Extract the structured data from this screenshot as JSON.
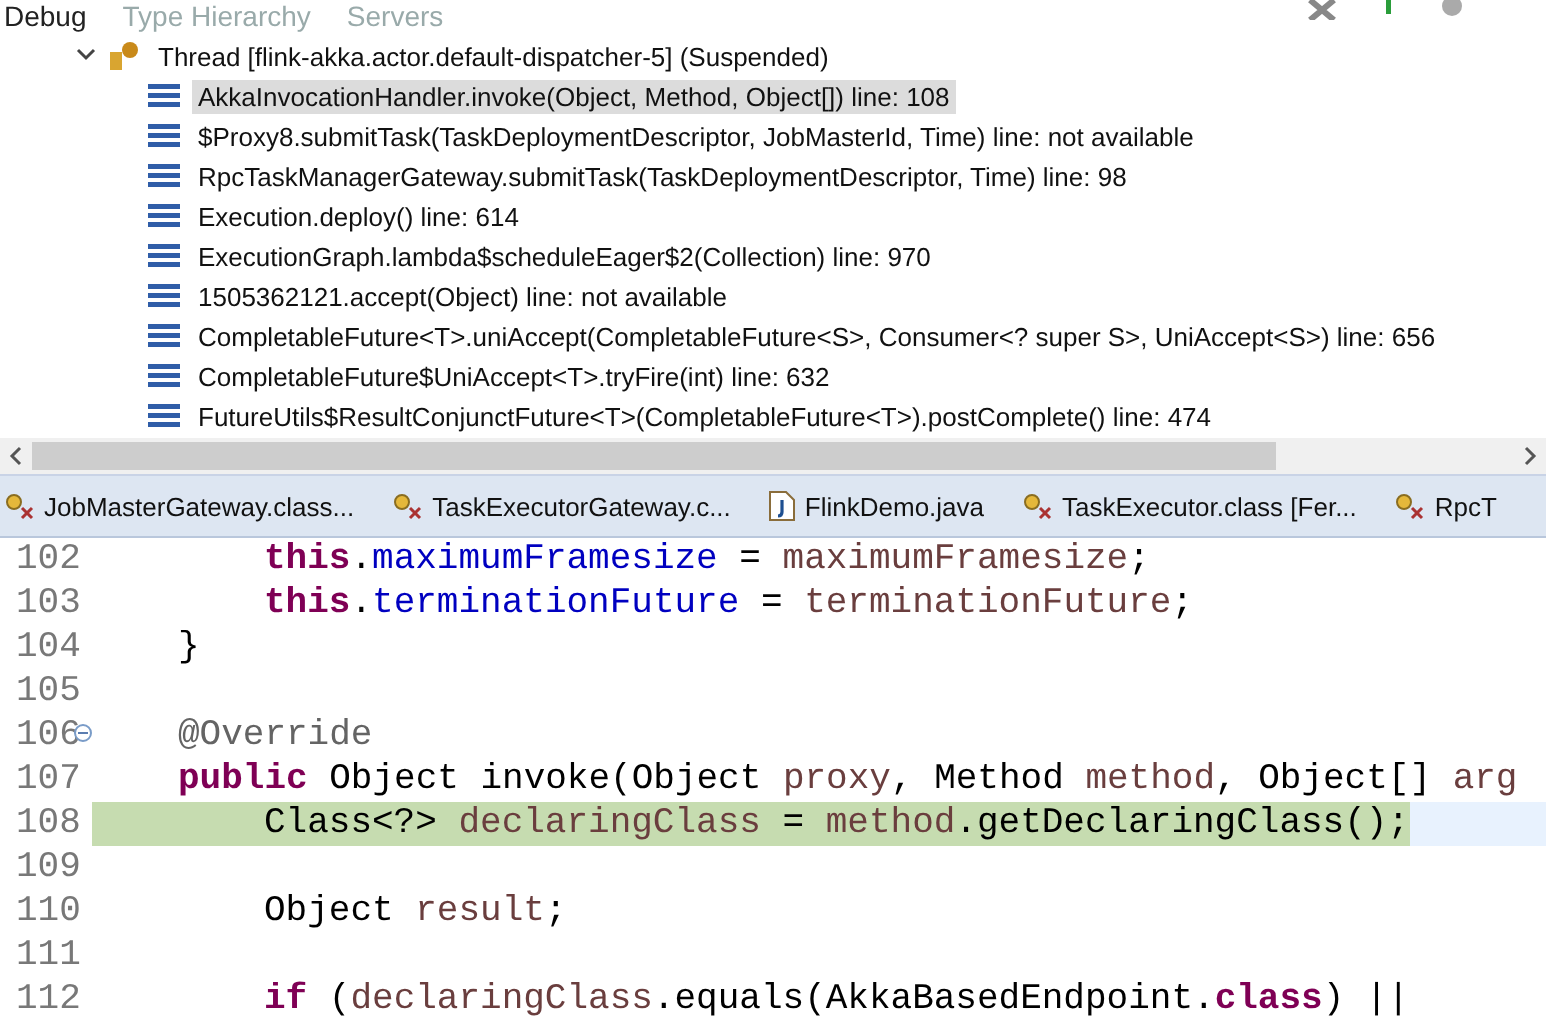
{
  "view_tabs": [
    {
      "label": "Debug",
      "selected": true
    },
    {
      "label": "Type Hierarchy",
      "selected": false
    },
    {
      "label": "Servers",
      "selected": false
    }
  ],
  "thread": {
    "label": "Thread [flink-akka.actor.default-dispatcher-5] (Suspended)",
    "expanded": true,
    "frames": [
      {
        "label": "AkkaInvocationHandler.invoke(Object, Method, Object[]) line: 108",
        "selected": true
      },
      {
        "label": "$Proxy8.submitTask(TaskDeploymentDescriptor, JobMasterId, Time) line: not available",
        "selected": false
      },
      {
        "label": "RpcTaskManagerGateway.submitTask(TaskDeploymentDescriptor, Time) line: 98",
        "selected": false
      },
      {
        "label": "Execution.deploy() line: 614",
        "selected": false
      },
      {
        "label": "ExecutionGraph.lambda$scheduleEager$2(Collection) line: 970",
        "selected": false
      },
      {
        "label": "1505362121.accept(Object) line: not available",
        "selected": false
      },
      {
        "label": "CompletableFuture<T>.uniAccept(CompletableFuture<S>, Consumer<? super S>, UniAccept<S>) line: 656",
        "selected": false
      },
      {
        "label": "CompletableFuture$UniAccept<T>.tryFire(int) line: 632",
        "selected": false
      },
      {
        "label": "FutureUtils$ResultConjunctFuture<T>(CompletableFuture<T>).postComplete() line: 474",
        "selected": false
      }
    ]
  },
  "editor_tabs": [
    {
      "label": "JobMasterGateway.class...",
      "kind": "class"
    },
    {
      "label": "TaskExecutorGateway.c...",
      "kind": "class"
    },
    {
      "label": "FlinkDemo.java",
      "kind": "java"
    },
    {
      "label": "TaskExecutor.class [Fer...",
      "kind": "class"
    },
    {
      "label": "RpcT",
      "kind": "class"
    }
  ],
  "code_lines": [
    {
      "number": "102",
      "current": false,
      "kind": "statement",
      "tokens": [
        {
          "kind": "keyword",
          "text": "this"
        },
        {
          "kind": "plain",
          "text": "."
        },
        {
          "kind": "field",
          "text": "maximumFramesize"
        },
        {
          "kind": "plain",
          "text": " = "
        },
        {
          "kind": "var",
          "text": "maximumFramesize"
        },
        {
          "kind": "plain",
          "text": ";"
        }
      ]
    },
    {
      "number": "103",
      "current": false,
      "kind": "statement",
      "tokens": [
        {
          "kind": "keyword",
          "text": "this"
        },
        {
          "kind": "plain",
          "text": "."
        },
        {
          "kind": "field",
          "text": "terminationFuture"
        },
        {
          "kind": "plain",
          "text": " = "
        },
        {
          "kind": "var",
          "text": "terminationFuture"
        },
        {
          "kind": "plain",
          "text": ";"
        }
      ]
    },
    {
      "number": "104",
      "current": false,
      "kind": "member",
      "tokens": [
        {
          "kind": "plain",
          "text": "}"
        }
      ]
    },
    {
      "number": "105",
      "current": false
    },
    {
      "number": "106",
      "current": false,
      "foldable": true,
      "kind": "member",
      "tokens": [
        {
          "kind": "annotation",
          "text": "@Override"
        }
      ]
    },
    {
      "number": "107",
      "current": false,
      "kind": "member",
      "tokens": [
        {
          "kind": "keyword",
          "text": "public"
        },
        {
          "kind": "plain",
          "text": " Object invoke(Object "
        },
        {
          "kind": "var",
          "text": "proxy"
        },
        {
          "kind": "plain",
          "text": ", Method "
        },
        {
          "kind": "var",
          "text": "method"
        },
        {
          "kind": "plain",
          "text": ", Object[] "
        },
        {
          "kind": "var",
          "text": "arg"
        }
      ]
    },
    {
      "number": "108",
      "current": true,
      "kind": "statement",
      "tokens": [
        {
          "kind": "plain",
          "text": "Class<?> "
        },
        {
          "kind": "var",
          "text": "declaringClass"
        },
        {
          "kind": "plain",
          "text": " = "
        },
        {
          "kind": "var",
          "text": "method"
        },
        {
          "kind": "plain",
          "text": ".getDeclaringClass();"
        }
      ]
    },
    {
      "number": "109",
      "current": false
    },
    {
      "number": "110",
      "current": false,
      "kind": "statement",
      "tokens": [
        {
          "kind": "plain",
          "text": "Object "
        },
        {
          "kind": "var",
          "text": "result"
        },
        {
          "kind": "plain",
          "text": ";"
        }
      ]
    },
    {
      "number": "111",
      "current": false
    },
    {
      "number": "112",
      "current": false,
      "kind": "statement",
      "tokens": [
        {
          "kind": "keyword",
          "text": "if"
        },
        {
          "kind": "plain",
          "text": " ("
        },
        {
          "kind": "var",
          "text": "declaringClass"
        },
        {
          "kind": "plain",
          "text": ".equals(AkkaBasedEndpoint."
        },
        {
          "kind": "keyword",
          "text": "class"
        },
        {
          "kind": "plain",
          "text": ") ||"
        }
      ]
    }
  ]
}
